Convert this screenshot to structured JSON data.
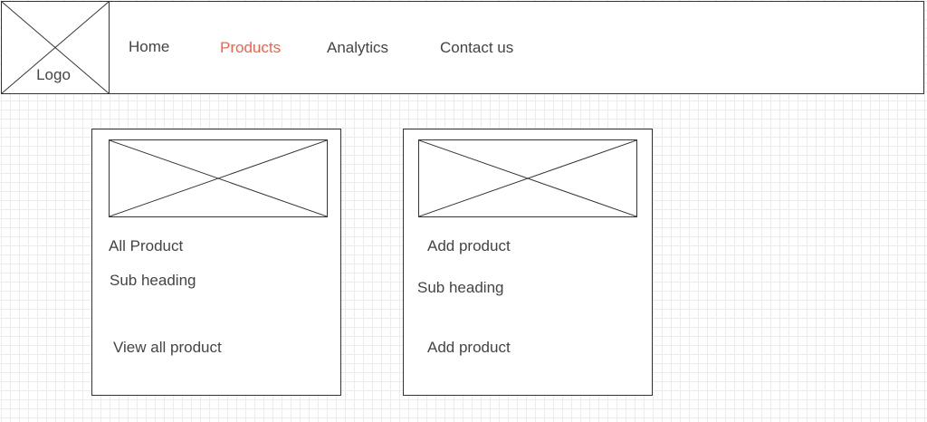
{
  "header": {
    "logo_label": "Logo",
    "nav": [
      {
        "label": "Home",
        "active": false
      },
      {
        "label": "Products",
        "active": true
      },
      {
        "label": "Analytics",
        "active": false
      },
      {
        "label": "Contact us",
        "active": false
      }
    ]
  },
  "cards": [
    {
      "title": "All Product",
      "subheading": "Sub heading",
      "action": "View all product"
    },
    {
      "title": "Add product",
      "subheading": "Sub heading",
      "action": "Add product"
    }
  ],
  "colors": {
    "active_nav": "#f2634b",
    "text": "#444444",
    "border": "#333333",
    "grid": "#ececec"
  }
}
